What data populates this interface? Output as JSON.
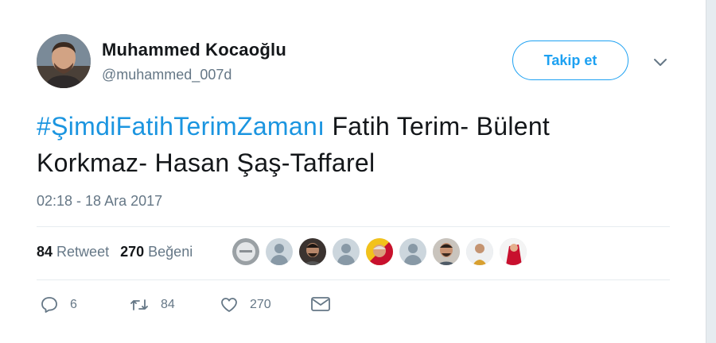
{
  "user": {
    "name": "Muhammed Kocaoğlu",
    "handle": "@muhammed_007d"
  },
  "follow_button": {
    "label": "Takip et"
  },
  "tweet": {
    "hashtag": "#ŞimdiFatihTerimZamanı",
    "text": " Fatih Terim- Bülent Korkmaz- Hasan Şaş-Taffarel",
    "timestamp": "02:18 - 18 Ara 2017"
  },
  "stats": {
    "retweet_count": "84",
    "retweet_label": "Retweet",
    "like_count": "270",
    "like_label": "Beğeni"
  },
  "actions": {
    "reply_count": "6",
    "retweet_count": "84",
    "like_count": "270"
  },
  "icons": {
    "reply": "reply-icon",
    "retweet": "retweet-icon",
    "like": "heart-icon",
    "message": "envelope-icon",
    "more": "chevron-down-icon"
  },
  "colors": {
    "accent": "#1da1f2",
    "hashtag": "#1b95e0",
    "secondary_text": "#657786",
    "primary_text": "#14171a"
  }
}
